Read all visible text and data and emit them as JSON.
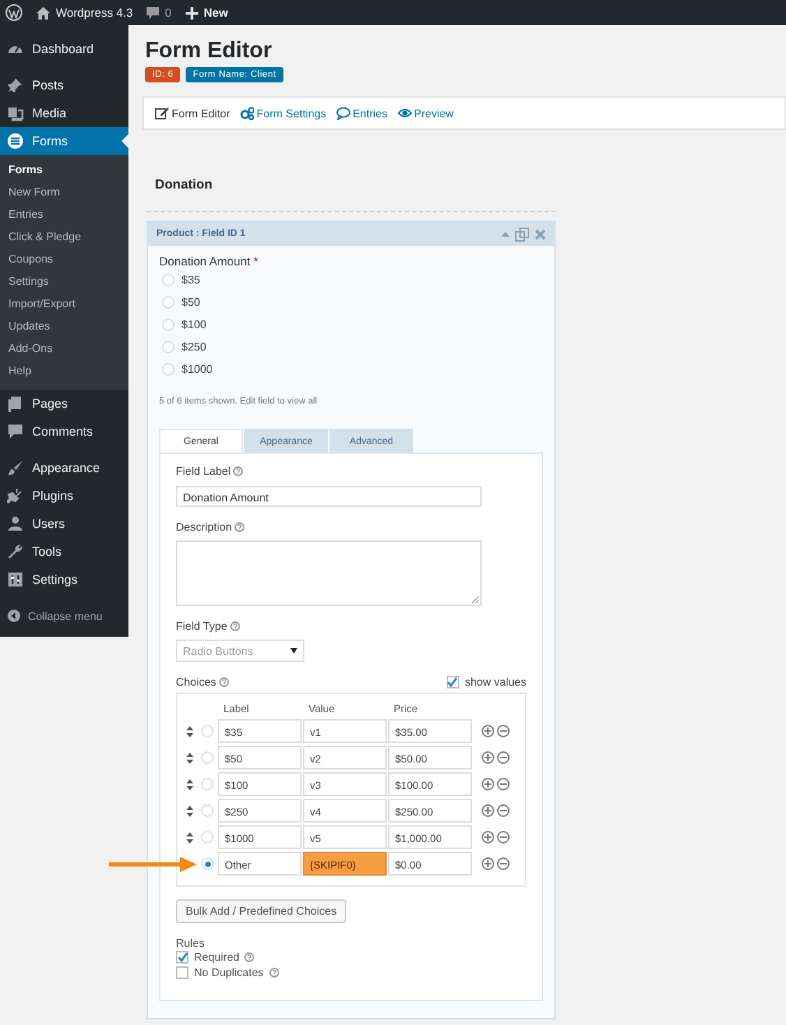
{
  "admin_bar": {
    "site": "Wordpress 4.3",
    "comments": "0",
    "new": "New"
  },
  "sidebar": {
    "groups": [
      [
        {
          "label": "Dashboard",
          "selected": false
        }
      ],
      [
        {
          "label": "Posts",
          "selected": false
        },
        {
          "label": "Media",
          "selected": false
        },
        {
          "label": "Forms",
          "selected": true,
          "children": [
            {
              "label": "Forms",
              "selected": true
            },
            {
              "label": "New Form",
              "selected": false
            },
            {
              "label": "Entries",
              "selected": false
            },
            {
              "label": "Click & Pledge",
              "selected": false
            },
            {
              "label": "Coupons",
              "selected": false
            },
            {
              "label": "Settings",
              "selected": false
            },
            {
              "label": "Import/Export",
              "selected": false
            },
            {
              "label": "Updates",
              "selected": false
            },
            {
              "label": "Add-Ons",
              "selected": false
            },
            {
              "label": "Help",
              "selected": false
            }
          ]
        },
        {
          "label": "Pages",
          "selected": false
        },
        {
          "label": "Comments",
          "selected": false
        }
      ],
      [
        {
          "label": "Appearance",
          "selected": false
        },
        {
          "label": "Plugins",
          "selected": false
        },
        {
          "label": "Users",
          "selected": false
        },
        {
          "label": "Tools",
          "selected": false
        },
        {
          "label": "Settings",
          "selected": false
        }
      ]
    ],
    "collapse": "Collapse menu"
  },
  "page": {
    "title": "Form Editor",
    "badges": [
      {
        "text": "ID: 6",
        "color": "#d54e21"
      },
      {
        "text": "Form Name: Client",
        "color": "#0074a2"
      }
    ],
    "toolbar": [
      {
        "label": "Form Editor",
        "selected": true
      },
      {
        "label": "Form Settings",
        "selected": false
      },
      {
        "label": "Entries",
        "selected": false
      },
      {
        "label": "Preview",
        "selected": false
      }
    ]
  },
  "form_title": "Donation",
  "field": {
    "header": "Product : Field ID 1",
    "label": "Donation Amount",
    "required_mark": "*",
    "options": [
      {
        "label": "$35",
        "selected": false
      },
      {
        "label": "$50",
        "selected": false
      },
      {
        "label": "$100",
        "selected": false
      },
      {
        "label": "$250",
        "selected": false
      },
      {
        "label": "$1000",
        "selected": false
      }
    ],
    "note": "5 of 6 items shown. Edit field to view all",
    "tabs": [
      {
        "label": "General",
        "selected": true
      },
      {
        "label": "Appearance",
        "selected": false
      },
      {
        "label": "Advanced",
        "selected": false
      }
    ],
    "settings": {
      "field_label": {
        "label": "Field Label",
        "value": "Donation Amount"
      },
      "description": {
        "label": "Description"
      },
      "field_type": {
        "label": "Field Type",
        "value": "Radio Buttons"
      },
      "choices": {
        "label": "Choices",
        "show_values": {
          "label": "show values",
          "checked": true
        },
        "columns": [
          "Label",
          "Value",
          "Price"
        ],
        "rows": [
          {
            "label": "$35",
            "value": "v1",
            "price": "$35.00",
            "selected": false,
            "highlighted": false
          },
          {
            "label": "$50",
            "value": "v2",
            "price": "$50.00",
            "selected": false,
            "highlighted": false
          },
          {
            "label": "$100",
            "value": "v3",
            "price": "$100.00",
            "selected": false,
            "highlighted": false
          },
          {
            "label": "$250",
            "value": "v4",
            "price": "$250.00",
            "selected": false,
            "highlighted": false
          },
          {
            "label": "$1000",
            "value": "v5",
            "price": "$1,000.00",
            "selected": false,
            "highlighted": false
          },
          {
            "label": "Other",
            "value": "{SKIPIF0}",
            "price": "$0.00",
            "selected": true,
            "highlighted": true
          }
        ]
      },
      "bulk_button": "Bulk Add / Predefined Choices",
      "rules": {
        "title": "Rules",
        "items": [
          {
            "label": "Required",
            "checked": true
          },
          {
            "label": "No Duplicates",
            "checked": false
          }
        ]
      }
    }
  }
}
